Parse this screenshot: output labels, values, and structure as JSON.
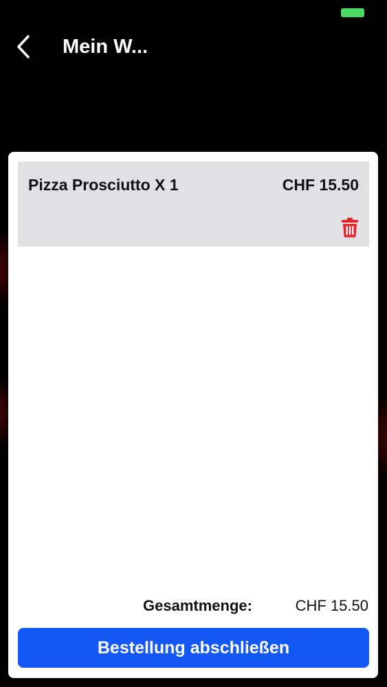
{
  "status_bar": {
    "battery_color": "#4cd964"
  },
  "header": {
    "back_icon": "chevron-left-icon",
    "title": "Mein W..."
  },
  "cart": {
    "items": [
      {
        "name": "Pizza Prosciutto X 1",
        "price": "CHF 15.50",
        "delete_icon": "trash-icon"
      }
    ],
    "total_label": "Gesamtmenge:",
    "total_value": "CHF 15.50",
    "checkout_label": "Bestellung abschließen"
  },
  "colors": {
    "background": "#000000",
    "card": "#ffffff",
    "item_background": "#e1e0e2",
    "delete": "#e8232a",
    "primary_button": "#1357f5"
  }
}
